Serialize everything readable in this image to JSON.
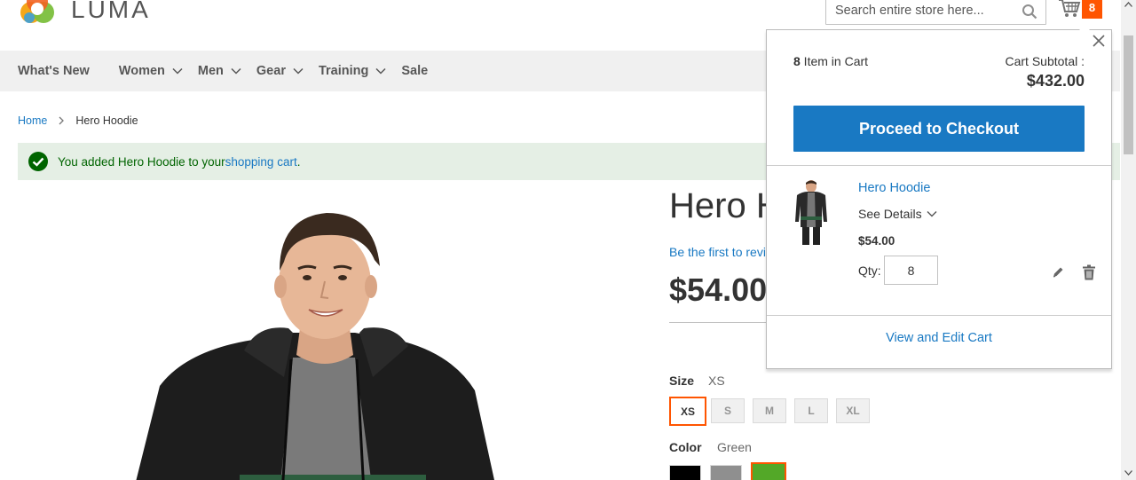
{
  "header": {
    "logo_text": "LUMA",
    "search_placeholder": "Search entire store here...",
    "cart_count": "8"
  },
  "nav": {
    "items": [
      {
        "label": "What's New",
        "has_submenu": false
      },
      {
        "label": "Women",
        "has_submenu": true
      },
      {
        "label": "Men",
        "has_submenu": true
      },
      {
        "label": "Gear",
        "has_submenu": true
      },
      {
        "label": "Training",
        "has_submenu": true
      },
      {
        "label": "Sale",
        "has_submenu": false
      }
    ]
  },
  "breadcrumb": {
    "home": "Home",
    "current": "Hero Hoodie"
  },
  "message": {
    "text_before": "You added Hero Hoodie to your ",
    "link": "shopping cart",
    "text_after": "."
  },
  "product": {
    "title": "Hero Hoodie",
    "review_link": "Be the first to review this product",
    "price": "$54.00",
    "size_label": "Size",
    "size_selected": "XS",
    "sizes": [
      "XS",
      "S",
      "M",
      "L",
      "XL"
    ],
    "color_label": "Color",
    "color_selected": "Green",
    "colors": [
      "#000000",
      "#8f8f8f",
      "#53a828"
    ]
  },
  "minicart": {
    "items_count_number": "8",
    "items_count_text": " Item in Cart",
    "subtotal_label": "Cart Subtotal :",
    "subtotal_amount": "$432.00",
    "checkout_label": "Proceed to Checkout",
    "item": {
      "name": "Hero Hoodie",
      "see_details": "See Details",
      "price": "$54.00",
      "qty_label": "Qty:",
      "qty_value": "8"
    },
    "view_cart_label": "View and Edit Cart"
  },
  "colors": {
    "accent_blue": "#1979c3",
    "cart_badge": "#ff5501",
    "success_bg": "#e5efe5",
    "success_text": "#006400"
  }
}
